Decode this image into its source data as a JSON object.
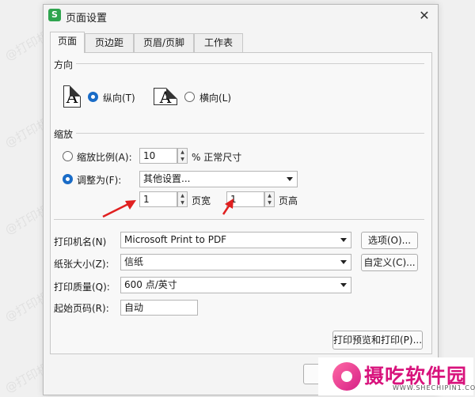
{
  "window": {
    "title": "页面设置",
    "app_icon_letter": "S"
  },
  "tabs": [
    {
      "label": "页面"
    },
    {
      "label": "页边距"
    },
    {
      "label": "页眉/页脚"
    },
    {
      "label": "工作表"
    }
  ],
  "orientation": {
    "section_label": "方向",
    "portrait_label": "纵向(T)",
    "landscape_label": "横向(L)",
    "icon_letter": "A",
    "selected": "portrait"
  },
  "scaling": {
    "section_label": "缩放",
    "scale_label": "缩放比例(A):",
    "scale_value": "10",
    "scale_suffix": "% 正常尺寸",
    "fit_label": "调整为(F):",
    "fit_select": "其他设置...",
    "pages_wide_value": "1",
    "pages_wide_label": "页宽",
    "pages_tall_value": "1",
    "pages_tall_label": "页高",
    "selected": "fit"
  },
  "printer": {
    "label": "打印机名(N)",
    "value": "Microsoft Print to PDF",
    "options_button": "选项(O)..."
  },
  "paper_size": {
    "label": "纸张大小(Z):",
    "value": "信纸",
    "custom_button": "自定义(C)..."
  },
  "print_quality": {
    "label": "打印质量(Q):",
    "value": "600 点/英寸"
  },
  "first_page": {
    "label": "起始页码(R):",
    "value": "自动"
  },
  "preview_button": "打印预览和打印(P)...",
  "watermark_text": "@打印机卫士",
  "logo": {
    "name": "摄吃软件园",
    "sub": "WWW.SHECHIPIN1.COM"
  },
  "colors": {
    "accent": "#1a6cc7",
    "annotation_arrow": "#e02020",
    "logo": "#d8137c"
  }
}
